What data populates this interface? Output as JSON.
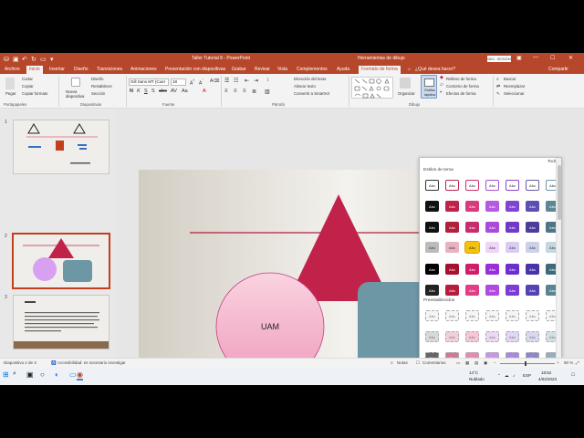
{
  "window": {
    "title": "Taller Tutorial 8  -  PowerPoint",
    "context_tool": "Herramientas de dibujo",
    "user_badge": "INIC. SESIÓN"
  },
  "tabs": [
    {
      "label": "Archivo"
    },
    {
      "label": "Inicio"
    },
    {
      "label": "Insertar"
    },
    {
      "label": "Diseño"
    },
    {
      "label": "Transiciones"
    },
    {
      "label": "Animaciones"
    },
    {
      "label": "Presentación con diapositivas"
    },
    {
      "label": "Grabar"
    },
    {
      "label": "Revisar"
    },
    {
      "label": "Vista"
    },
    {
      "label": "Complementos"
    },
    {
      "label": "Ayuda"
    },
    {
      "label": "Formato de forma"
    }
  ],
  "tell_me": "¿Qué desea hacer?",
  "share": "Compartir",
  "ribbon": {
    "clipboard": {
      "paste": "Pegar",
      "cut": "Cortar",
      "copy": "Copiar",
      "format_painter": "Copiar formato",
      "group": "Portapapeles"
    },
    "slides": {
      "new_slide": "Nueva diapositiva",
      "layout": "Diseño",
      "reset": "Restablecer",
      "section": "Sección",
      "group": "Diapositivas"
    },
    "font": {
      "font_name": "Gill Sans MT (Cuer",
      "font_size": "18",
      "group": "Fuente"
    },
    "paragraph": {
      "text_direction": "Dirección del texto",
      "align_text": "Alinear texto",
      "smartart": "Convertir a SmartArt",
      "group": "Párrafo"
    },
    "drawing": {
      "arrange": "Organizar",
      "quick_styles": "Estilos rápidos",
      "fill": "Relleno de forma",
      "outline": "Contorno de forma",
      "effects": "Efectos de forma",
      "group": "Dibujo"
    },
    "editing": {
      "find": "Buscar",
      "replace": "Reemplazar",
      "select": "Seleccionar"
    }
  },
  "thumbnails": [
    {
      "num": "1"
    },
    {
      "num": "2"
    },
    {
      "num": "3"
    }
  ],
  "slide": {
    "circle_text": "UAM"
  },
  "gallery": {
    "filter": "Todos",
    "theme_styles_header": "Estilos de tema",
    "presets_header": "Preestablecidos",
    "swatch_label": "Abc"
  },
  "status": {
    "slide_count": "Diapositiva 2 de 3",
    "accessibility": "Accesibilidad: es necesario investigar",
    "notes": "Notas",
    "comments": "Comentarios",
    "zoom": "90 %"
  },
  "taskbar": {
    "weather_temp": "14°C",
    "weather_desc": "Nublado",
    "lang": "ESP",
    "time": "18:52",
    "date": "4/02/2023"
  },
  "colors": {
    "accent": "#b7472a",
    "triangle": "#c0224a",
    "circle": "#f5b8cd",
    "rect": "#6e97a6"
  }
}
